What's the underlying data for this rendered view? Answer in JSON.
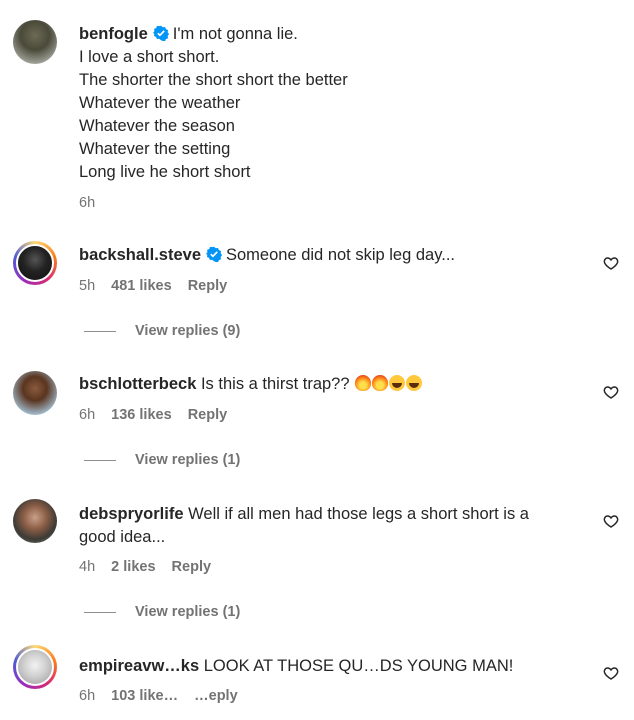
{
  "comments": [
    {
      "username": "benfogle",
      "verified": true,
      "lines": [
        "I'm not gonna lie.",
        "I love a short short.",
        "The shorter the short short the better",
        "Whatever the weather",
        "Whatever the season",
        "Whatever the setting",
        "Long live he short short"
      ],
      "time": "6h"
    },
    {
      "username": "backshall.steve",
      "verified": true,
      "text": "Someone did not skip leg day...",
      "time": "5h",
      "likes": "481 likes",
      "reply": "Reply",
      "view_replies": "View replies (9)"
    },
    {
      "username": "bschlotterbeck",
      "text": "Is this a thirst trap??",
      "emojis": [
        "fire",
        "fire",
        "laughing",
        "laughing"
      ],
      "time": "6h",
      "likes": "136 likes",
      "reply": "Reply",
      "view_replies": "View replies (1)"
    },
    {
      "username": "debspryorlife",
      "text_line1": "Well if all men had those legs a short short is a",
      "text_line2": "good idea...",
      "time": "4h",
      "likes": "2 likes",
      "reply": "Reply",
      "view_replies": "View replies (1)"
    },
    {
      "username": "empireavw",
      "username_partial": "…ks",
      "text": "LOOK AT THOSE QU…DS YOUNG MAN!",
      "time": "6h",
      "likes": "103 like…",
      "reply": "…eply"
    }
  ],
  "icons": {
    "heart": "heart-outline-icon",
    "verified": "verified-badge-icon"
  },
  "colors": {
    "verified": "#0095f6",
    "secondary_text": "#737373"
  }
}
